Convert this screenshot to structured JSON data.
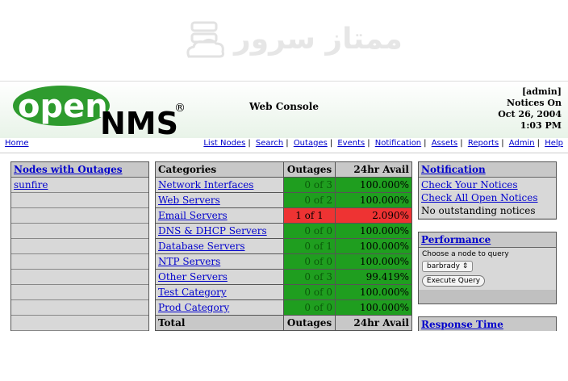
{
  "watermark": {
    "text": "ممتاز سرور"
  },
  "header": {
    "logo_open": "open",
    "logo_nms": "NMS",
    "logo_reg": "®",
    "title": "Web Console",
    "user": "[admin]",
    "notices": "Notices On",
    "date": "Oct 26, 2004",
    "time": "1:03 PM"
  },
  "nav": {
    "home": "Home",
    "links": [
      "List Nodes",
      "Search",
      "Outages",
      "Events",
      "Notification",
      "Assets",
      "Reports",
      "Admin",
      "Help"
    ],
    "separator": "|"
  },
  "outages_panel": {
    "title": "Nodes with Outages",
    "items": [
      "sunfire"
    ]
  },
  "categories": {
    "header": {
      "name": "Categories",
      "outages": "Outages",
      "avail": "24hr Avail"
    },
    "rows": [
      {
        "name": "Network Interfaces",
        "outages": "0 of 3",
        "avail": "100.000%",
        "status": "green"
      },
      {
        "name": "Web Servers",
        "outages": "0 of 2",
        "avail": "100.000%",
        "status": "green"
      },
      {
        "name": "Email Servers",
        "outages": "1 of 1",
        "avail": "2.090%",
        "status": "red"
      },
      {
        "name": "DNS & DHCP Servers",
        "outages": "0 of 0",
        "avail": "100.000%",
        "status": "green"
      },
      {
        "name": "Database Servers",
        "outages": "0 of 1",
        "avail": "100.000%",
        "status": "green"
      },
      {
        "name": "NTP Servers",
        "outages": "0 of 0",
        "avail": "100.000%",
        "status": "green"
      },
      {
        "name": "Other Servers",
        "outages": "0 of 3",
        "avail": "99.419%",
        "status": "green"
      },
      {
        "name": "Test Category",
        "outages": "0 of 0",
        "avail": "100.000%",
        "status": "green"
      },
      {
        "name": "Prod Category",
        "outages": "0 of 0",
        "avail": "100.000%",
        "status": "green"
      }
    ],
    "footer": {
      "name": "Total",
      "outages": "Outages",
      "avail": "24hr Avail"
    }
  },
  "notification": {
    "title": "Notification",
    "links": [
      "Check Your Notices",
      "Check All Open Notices"
    ],
    "status": "No outstanding notices"
  },
  "performance": {
    "title": "Performance",
    "label": "Choose a node to query",
    "selected": "barbrady",
    "button": "Execute Query"
  },
  "response_time": {
    "title": "Response Time"
  },
  "colors": {
    "green": "#1f9e1f",
    "red": "#ee3333",
    "panel": "#c0c0c0",
    "link": "#0000cc"
  }
}
